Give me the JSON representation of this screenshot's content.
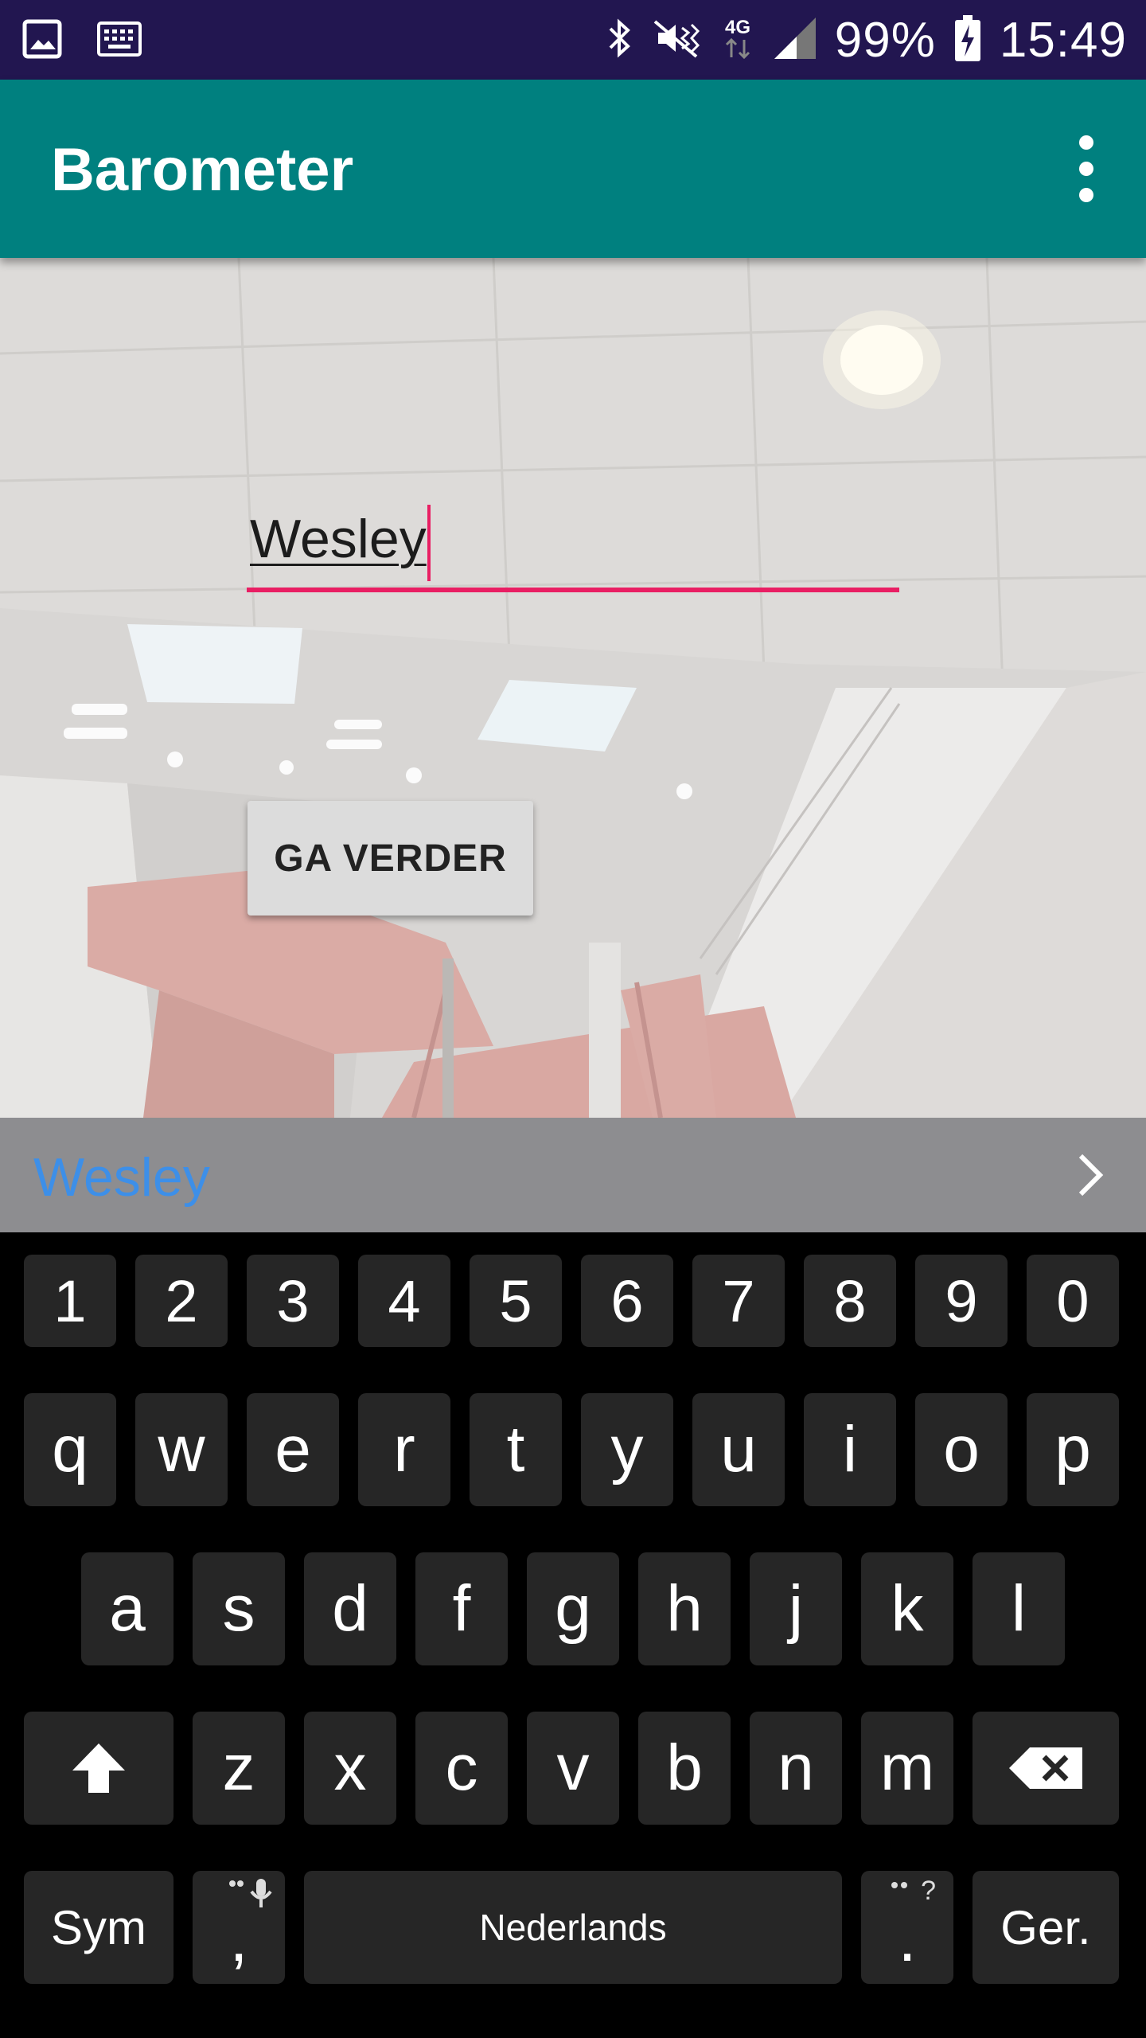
{
  "status_bar": {
    "battery": "99%",
    "time": "15:49",
    "network": "4G",
    "icons": [
      "gallery-icon",
      "keyboard-icon",
      "bluetooth-icon",
      "mute-vibrate-icon",
      "network-4g-icon",
      "signal-icon",
      "battery-charging-icon"
    ]
  },
  "app_bar": {
    "title": "Barometer",
    "menu_icon": "more-vert-icon"
  },
  "form": {
    "name_value": "Wesley",
    "button_label": "GA VERDER",
    "accent": "#e91e63"
  },
  "suggestion_bar": {
    "suggestion": "Wesley",
    "more_icon": "chevron-right-icon"
  },
  "keyboard": {
    "number_row": [
      "1",
      "2",
      "3",
      "4",
      "5",
      "6",
      "7",
      "8",
      "9",
      "0"
    ],
    "row1": [
      "q",
      "w",
      "e",
      "r",
      "t",
      "y",
      "u",
      "i",
      "o",
      "p"
    ],
    "row2": [
      "a",
      "s",
      "d",
      "f",
      "g",
      "h",
      "j",
      "k",
      "l"
    ],
    "row3": [
      "z",
      "x",
      "c",
      "v",
      "b",
      "n",
      "m"
    ],
    "shift_icon": "shift-icon",
    "backspace_icon": "backspace-icon",
    "sym_label": "Sym",
    "comma_label": ",",
    "comma_hint_icon": "microphone-icon",
    "space_label": "Nederlands",
    "period_label": ".",
    "period_hint": "?",
    "enter_label": "Ger."
  },
  "colors": {
    "status_bar": "#221650",
    "app_bar": "#00807f",
    "suggestion": "#3d8fe8"
  }
}
